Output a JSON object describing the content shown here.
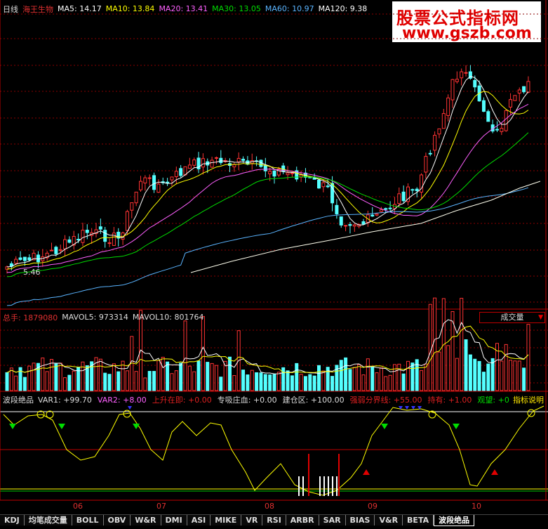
{
  "price_panel": {
    "period": "日线",
    "stock_name": "海王生物",
    "ma": [
      {
        "label": "MA5: 14.17",
        "color": "#ffffff"
      },
      {
        "label": "MA10: 13.84",
        "color": "#ffff00"
      },
      {
        "label": "MA20: 13.41",
        "color": "#ff60ff"
      },
      {
        "label": "MA30: 13.05",
        "color": "#00dd00"
      },
      {
        "label": "MA60: 10.97",
        "color": "#5ab4ff"
      },
      {
        "label": "MA120: 9.38",
        "color": "#ffffff"
      }
    ],
    "low_marker": "5.46"
  },
  "watermark": {
    "title": "股票公式指标网",
    "url": "www.gszb.com"
  },
  "volume_panel": {
    "total_label": "总手: 1879080",
    "mavol5": "MAVOL5: 973314",
    "mavol10": "MAVOL10: 801764",
    "dropdown": "成交量"
  },
  "indicator_panel": {
    "name": "波段绝品",
    "items": [
      {
        "label": "VAR1: +99.70",
        "color": "#dddddd"
      },
      {
        "label": "VAR2: +8.00",
        "color": "#ff60ff"
      },
      {
        "label": "上升在即: +0.00",
        "color": "#e02020"
      },
      {
        "label": "专吸庄血: +0.00",
        "color": "#dddddd"
      },
      {
        "label": "建仓区: +100.00",
        "color": "#dddddd"
      },
      {
        "label": "强弱分界线: +55.00",
        "color": "#e02020"
      },
      {
        "label": "持有: +1.00",
        "color": "#e02020"
      },
      {
        "label": "观望: +0",
        "color": "#00dd00"
      }
    ],
    "help": "指标说明"
  },
  "x_axis": [
    "06",
    "07",
    "08",
    "09",
    "10"
  ],
  "tabs": [
    "KDJ",
    "均笔成交量",
    "BOLL",
    "OBV",
    "W&R",
    "DMI",
    "ASI",
    "MIKE",
    "VR",
    "RSI",
    "ARBR",
    "SAR",
    "BIAS",
    "V&R",
    "BETA",
    "波段绝品"
  ],
  "active_tab": "波段绝品",
  "colors": {
    "up": "#ff3333",
    "down": "#54ffff",
    "grid": "#8b0000"
  }
}
